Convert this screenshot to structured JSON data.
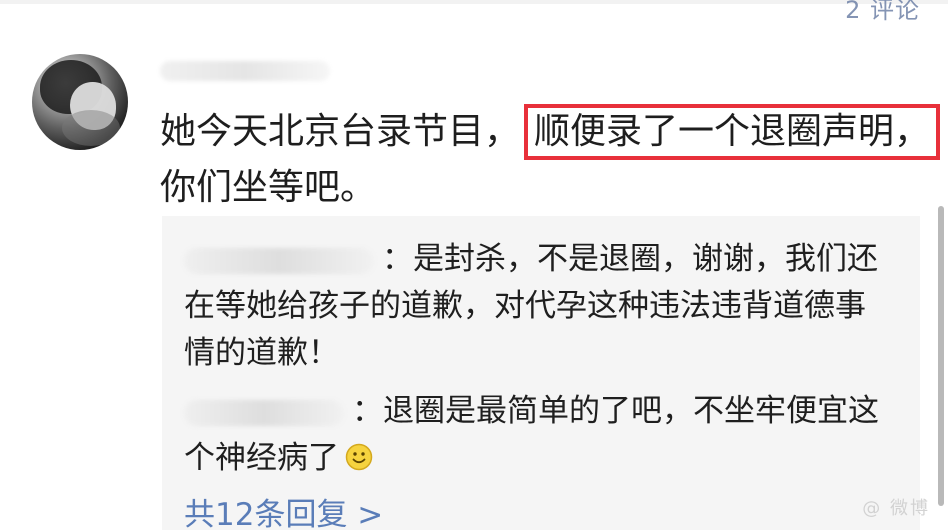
{
  "header": {
    "cut_text": "2 评论"
  },
  "post": {
    "line1_before": "她今天北京台录节目，",
    "line1_highlight": "顺便录了一个退圈声明，",
    "line2": "你们坐等吧。"
  },
  "replies": [
    {
      "text": "：是封杀，不是退圈，谢谢，我们还在等她给孩子的道歉，对代孕这种违法违背道德事情的道歉！"
    },
    {
      "text": "：退圈是最简单的了吧，不坐牢便宜这个神经病了"
    }
  ],
  "more_replies": "共12条回复 >",
  "colors": {
    "highlight": "#e8303a",
    "link": "#5a7db8",
    "reply_bg": "#f5f5f5"
  },
  "icons": {
    "avatar": "avatar-icon",
    "emoji": "smile-icon"
  }
}
